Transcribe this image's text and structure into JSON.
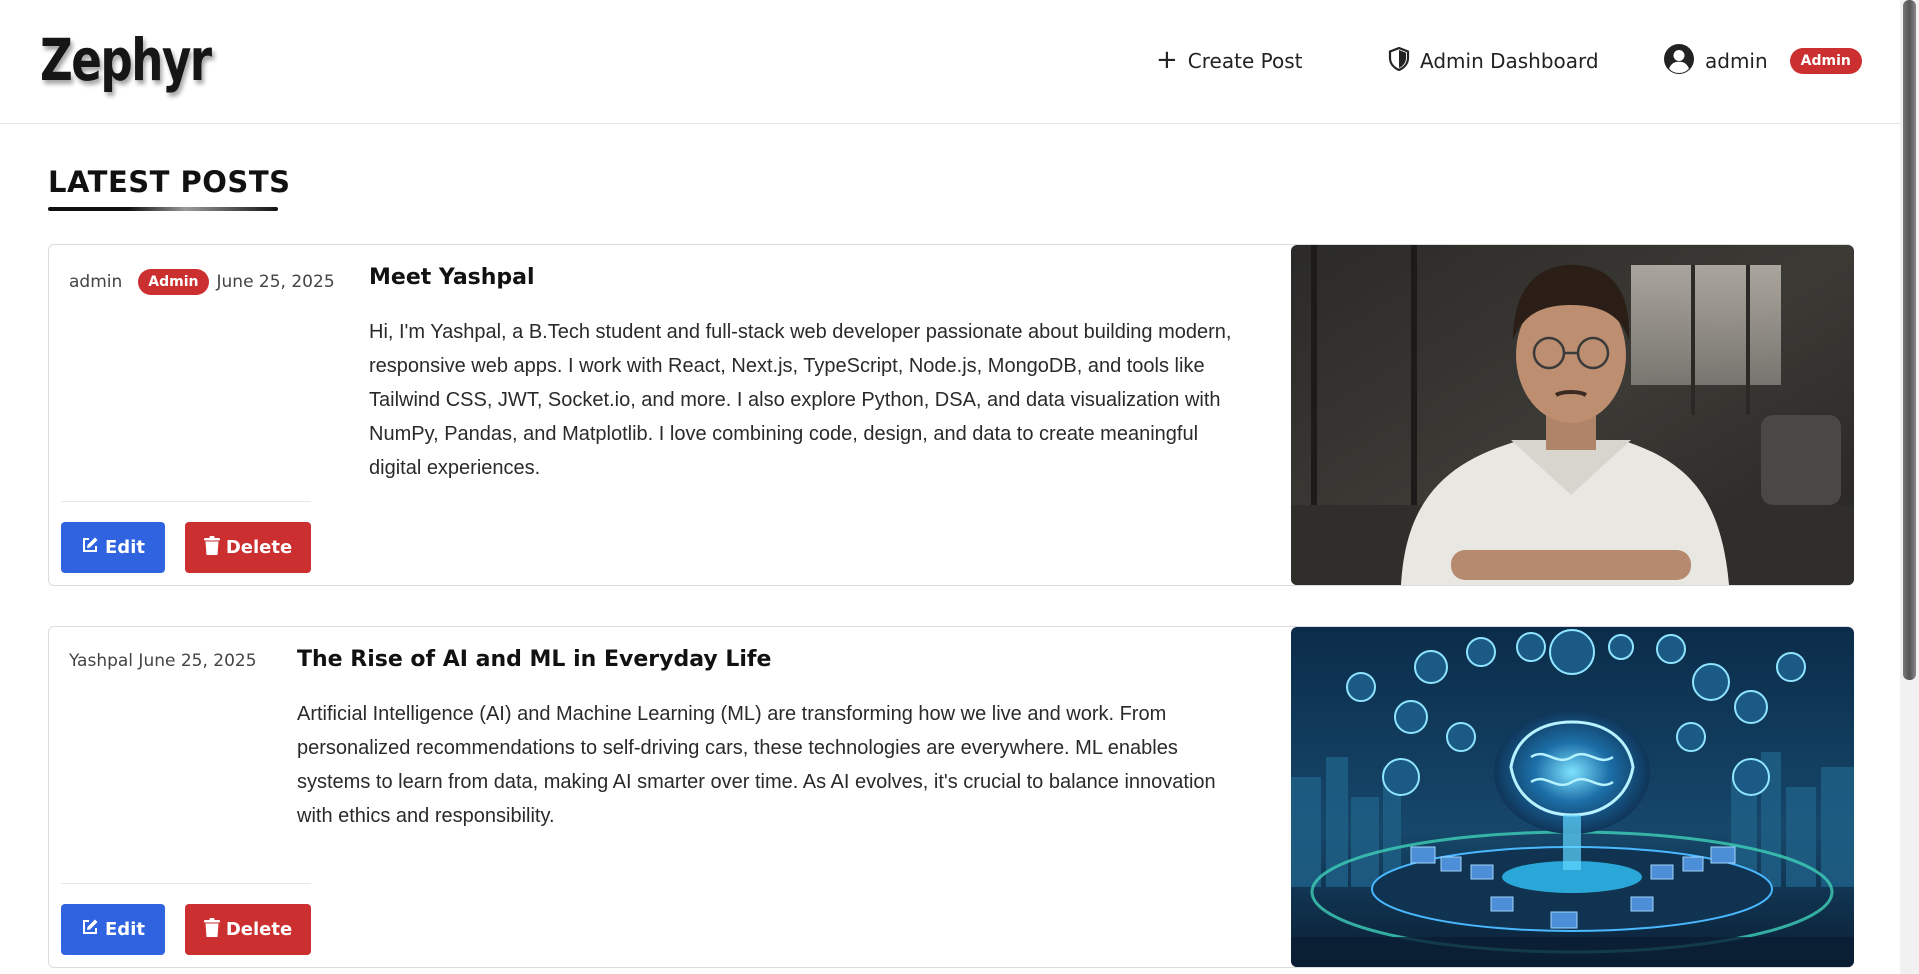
{
  "header": {
    "logo": "Zephyr",
    "nav": {
      "create_post": "Create Post",
      "admin_dashboard": "Admin Dashboard",
      "username": "admin",
      "role_badge": "Admin"
    }
  },
  "section_title": "LATEST POSTS",
  "posts": [
    {
      "author": "admin",
      "badge": "Admin",
      "date": "June 25, 2025",
      "title": "Meet Yashpal",
      "body": "Hi, I'm Yashpal, a B.Tech student and full-stack web developer passionate about building modern, responsive web apps. I work with React, Next.js, TypeScript, Node.js, MongoDB, and tools like Tailwind CSS, JWT, Socket.io, and more. I also explore Python, DSA, and data visualization with NumPy, Pandas, and Matplotlib. I love combining code, design, and data to create meaningful digital experiences.",
      "edit_label": "Edit",
      "delete_label": "Delete"
    },
    {
      "author_date": "Yashpal June 25, 2025",
      "title": "The Rise of AI and ML in Everyday Life",
      "body": "Artificial Intelligence (AI) and Machine Learning (ML) are transforming how we live and work. From personalized recommendations to self-driving cars, these technologies are everywhere. ML enables systems to learn from data, making AI smarter over time. As AI evolves, it's crucial to balance innovation with ethics and responsibility.",
      "edit_label": "Edit",
      "delete_label": "Delete"
    }
  ],
  "colors": {
    "edit_button": "#2f63e0",
    "delete_button": "#cc2f2f",
    "admin_badge": "#cc2f2f"
  },
  "icons": {
    "create": "plus-icon",
    "admin_dashboard": "shield-icon",
    "user": "user-avatar-icon",
    "edit": "edit-icon",
    "delete": "trash-icon"
  }
}
